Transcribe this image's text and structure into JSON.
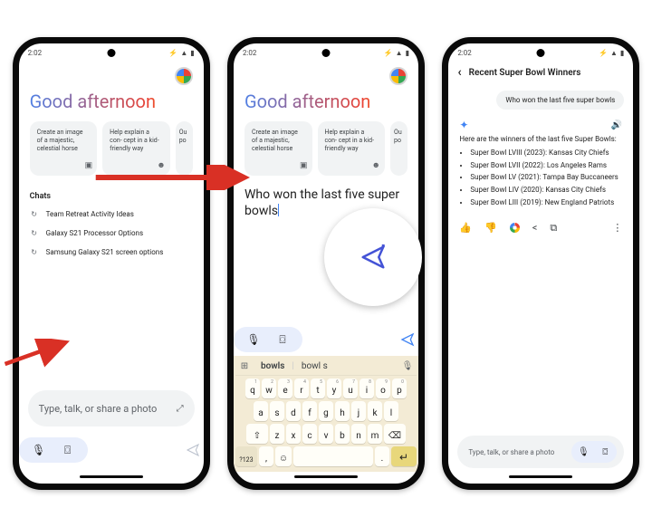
{
  "status": {
    "time": "2:02",
    "bolt": "⚡"
  },
  "greeting": "Good afternoon",
  "suggestions": [
    {
      "text": "Create an image of a majestic, celestial horse",
      "icon": "▣"
    },
    {
      "text": "Help explain a con-\ncept in a kid-friendly way",
      "icon": "☻"
    }
  ],
  "suggestion_overflow": "Ou\npo",
  "chats_label": "Chats",
  "chats": [
    "Team Retreat Activity Ideas",
    "Galaxy S21 Processor Options",
    "Samsung Galaxy S21 screen options"
  ],
  "composer_placeholder": "Type, talk, or share a photo",
  "typed_text_line1": "Who won the last five super",
  "typed_text_line2": "bowls",
  "keyboard_suggestions": [
    "bowls",
    "bowl s"
  ],
  "keyboard": {
    "row1": [
      "q",
      "w",
      "e",
      "r",
      "t",
      "y",
      "u",
      "i",
      "o",
      "p"
    ],
    "row1_nums": [
      "1",
      "2",
      "3",
      "4",
      "5",
      "6",
      "7",
      "8",
      "9",
      "0"
    ],
    "row2": [
      "a",
      "s",
      "d",
      "f",
      "g",
      "h",
      "j",
      "k",
      "l"
    ],
    "row3_mid": [
      "z",
      "x",
      "c",
      "v",
      "b",
      "n",
      "m"
    ],
    "symkey": "?123",
    "comma": ",",
    "period": ".",
    "enter": "↵"
  },
  "answer": {
    "back": "‹",
    "title": "Recent Super Bowl Winners",
    "user_chip": "Who won the last five super bowls",
    "intro": "Here are the winners of the last five Super Bowls:",
    "items": [
      "Super Bowl LVIII (2023): Kansas City Chiefs",
      "Super Bowl LVII (2022): Los Angeles Rams",
      "Super Bowl LV (2021): Tampa Bay Buccaneers",
      "Super Bowl LIV (2020): Kansas City Chiefs",
      "Super Bowl LIII (2019): New England Patriots"
    ]
  },
  "icons": {
    "history": "↻",
    "expand": "⤢",
    "mic": "🎙",
    "camera": "⌼",
    "send": "➤",
    "sparkle": "✦",
    "speaker": "🔊",
    "thumb_up": "👍",
    "thumb_down": "👎",
    "share": "<",
    "copy": "⧉",
    "more": "⋮",
    "shift": "⇧",
    "backspace": "⌫",
    "emoji": "☺",
    "menu4": "⊞"
  }
}
